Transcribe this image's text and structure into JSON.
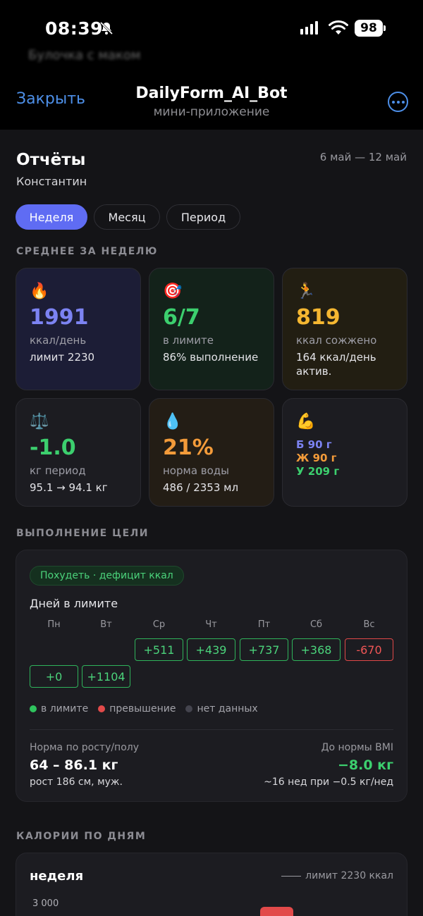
{
  "status_bar": {
    "time": "08:39",
    "battery": "98"
  },
  "blurred_message": "Булочка с маком",
  "header": {
    "close": "Закрыть",
    "title": "DailyForm_AI_Bot",
    "subtitle": "мини-приложение"
  },
  "report": {
    "title": "Отчёты",
    "user": "Константин",
    "range": "6 май — 12 май",
    "tabs": [
      {
        "label": "Неделя",
        "active": true
      },
      {
        "label": "Месяц",
        "active": false
      },
      {
        "label": "Период",
        "active": false
      }
    ]
  },
  "weekly_avg": {
    "label": "СРЕДНЕЕ ЗА НЕДЕЛЮ",
    "cards": [
      {
        "icon": "fire-icon",
        "value": "1991",
        "unit": "ккал/день",
        "sub": "лимит 2230",
        "color": "#7c83f2"
      },
      {
        "icon": "target-icon",
        "value": "6/7",
        "unit": "в лимите",
        "sub": "86% выполнение",
        "color": "#3ccf6e"
      },
      {
        "icon": "runner-icon",
        "value": "819",
        "unit": "ккал сожжено",
        "sub": "164 ккал/день актив.",
        "color": "#f5b731"
      },
      {
        "icon": "scales-icon",
        "value": "-1.0",
        "unit": "кг период",
        "sub": "95.1 → 94.1 кг",
        "color": "#3ccf6e"
      },
      {
        "icon": "droplet-icon",
        "value": "21%",
        "unit": "норма воды",
        "sub": "486 / 2353 мл",
        "color": "#f39b3a"
      }
    ],
    "macros": {
      "icon": "muscle-icon",
      "protein": "Б 90 г",
      "fat": "Ж 90 г",
      "carbs": "У 209 г"
    }
  },
  "goal": {
    "label": "ВЫПОЛНЕНИЕ ЦЕЛИ",
    "pill": "Похудеть · дефицит ккал",
    "days_title": "Дней в лимите",
    "weekdays": [
      "Пн",
      "Вт",
      "Ср",
      "Чт",
      "Пт",
      "Сб",
      "Вс"
    ],
    "row1": [
      "+511",
      "+439",
      "+737",
      "+368",
      "-670"
    ],
    "row2": [
      "+0",
      "+1104"
    ],
    "legend": {
      "in_limit": "в лимите",
      "over": "превышение",
      "no_data": "нет данных"
    },
    "norm_label": "Норма по росту/полу",
    "norm_value": "64 – 86.1 кг",
    "norm_sub": "рост 186 см, муж.",
    "bmi_label": "До нормы BMI",
    "bmi_value": "−8.0 кг",
    "bmi_sub": "~16 нед при −0.5 кг/нед"
  },
  "calories": {
    "label": "КАЛОРИИ ПО ДНЯМ",
    "title": "неделя",
    "limit": "лимит 2230 ккал",
    "tick": "3 000"
  }
}
